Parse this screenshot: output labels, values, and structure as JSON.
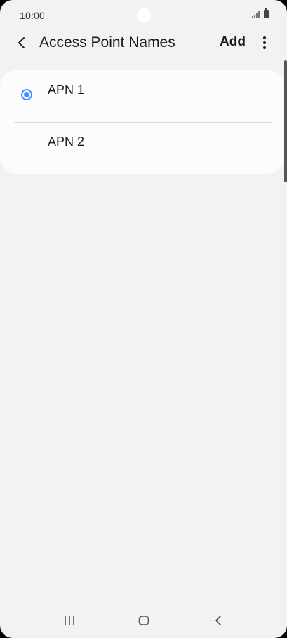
{
  "status_bar": {
    "time": "10:00"
  },
  "app_bar": {
    "title": "Access Point Names",
    "add_label": "Add"
  },
  "apn_list": [
    {
      "label": "APN 1",
      "selected": true
    },
    {
      "label": "APN 2",
      "selected": false
    }
  ],
  "colors": {
    "accent": "#3e91ff",
    "background": "#f2f2f2",
    "card": "#fcfcfc"
  }
}
